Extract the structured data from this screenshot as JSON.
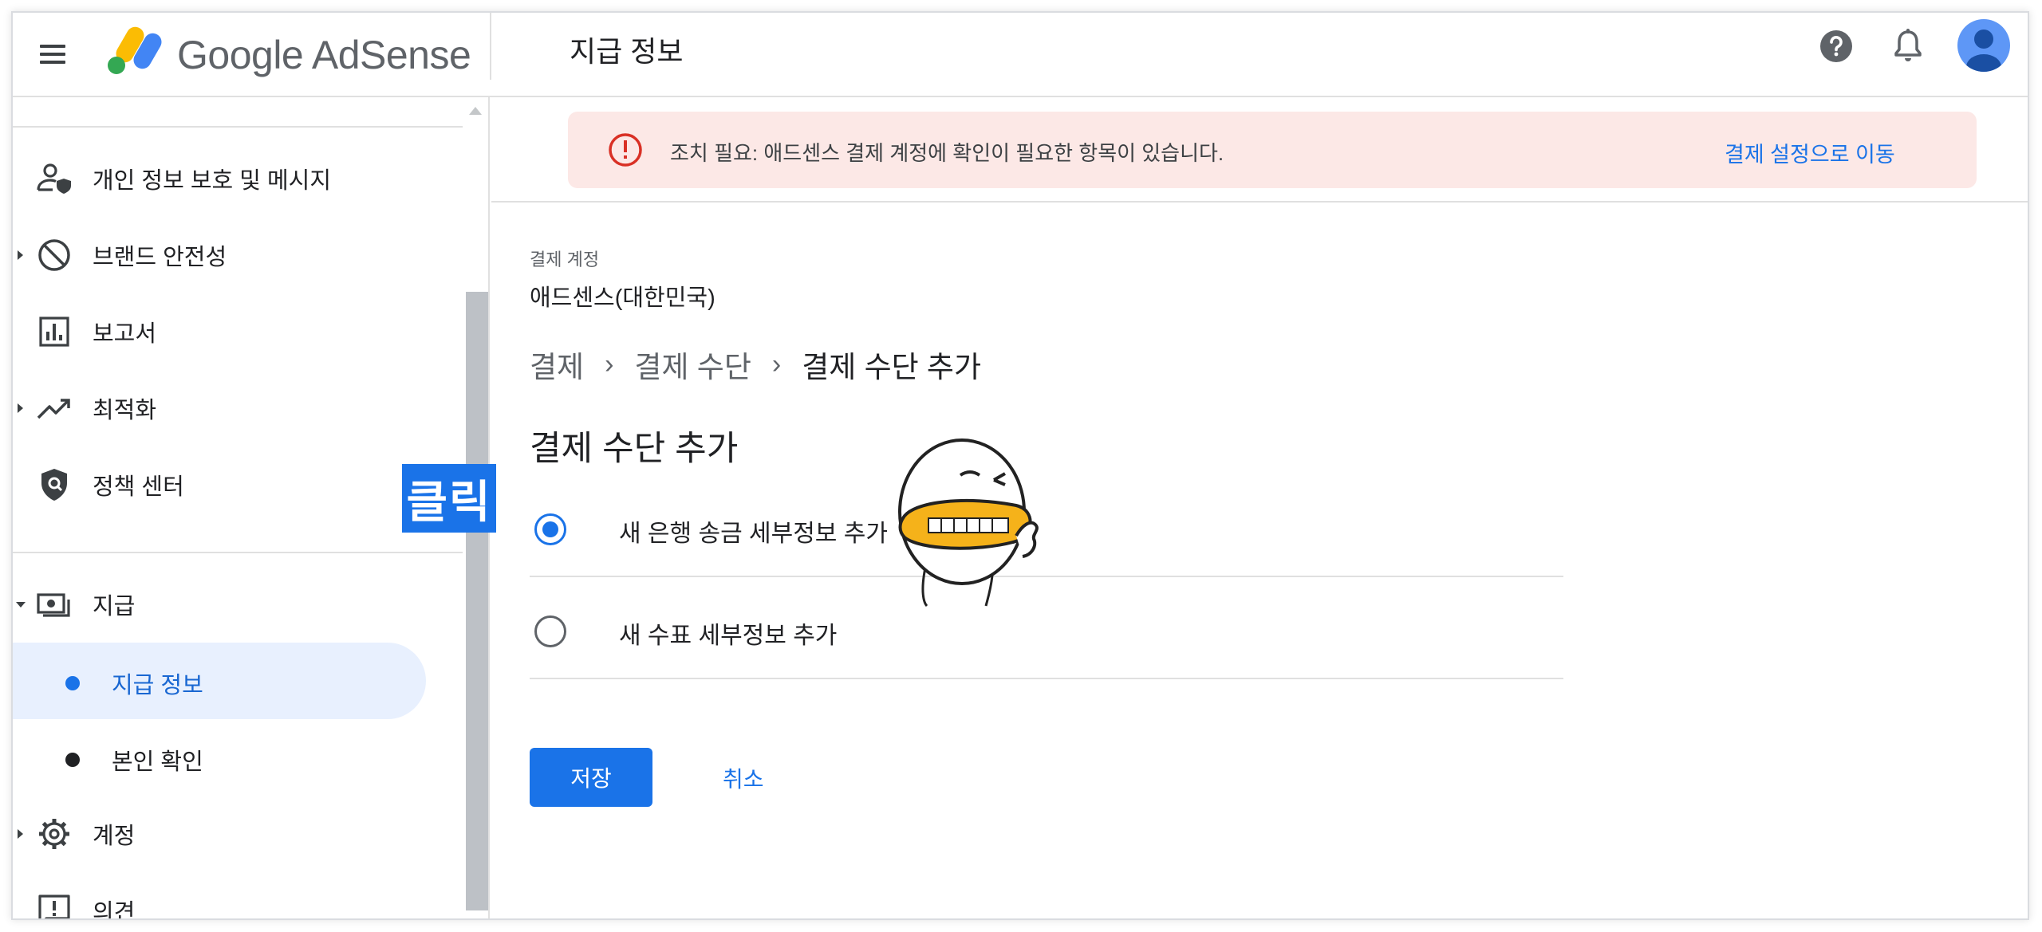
{
  "header": {
    "brand": "Google AdSense",
    "page_title": "지급 정보"
  },
  "sidebar": {
    "items": [
      {
        "label": "개인 정보 보호 및 메시지",
        "icon": "privacy-messaging-icon"
      },
      {
        "label": "브랜드 안전성",
        "icon": "block-icon"
      },
      {
        "label": "보고서",
        "icon": "bar-chart-icon"
      },
      {
        "label": "최적화",
        "icon": "trending-up-icon"
      },
      {
        "label": "정책 센터",
        "icon": "shield-icon"
      },
      {
        "label": "지급",
        "icon": "payments-icon"
      },
      {
        "label": "계정",
        "icon": "gear-icon"
      },
      {
        "label": "의견",
        "icon": "feedback-icon"
      }
    ],
    "sub_items": [
      {
        "label": "지급 정보",
        "active": true
      },
      {
        "label": "본인 확인",
        "active": false
      }
    ]
  },
  "annotation": {
    "click_label": "클릭"
  },
  "alert": {
    "message": "조치 필요: 애드센스 결제 계정에 확인이 필요한 항목이 있습니다.",
    "link": "결제 설정으로 이동"
  },
  "main": {
    "account_label": "결제 계정",
    "account_value": "애드센스(대한민국)",
    "breadcrumb": [
      "결제",
      "결제 수단",
      "결제 수단 추가"
    ],
    "section_title": "결제 수단 추가",
    "options": [
      {
        "label": "새 은행 송금 세부정보 추가",
        "selected": true
      },
      {
        "label": "새 수표 세부정보 추가",
        "selected": false
      }
    ],
    "save_label": "저장",
    "cancel_label": "취소"
  },
  "colors": {
    "accent": "#1a73e8",
    "alert_bg": "#fce8e6",
    "alert_icon": "#d93025",
    "active_nav_bg": "#e8f0fe"
  }
}
